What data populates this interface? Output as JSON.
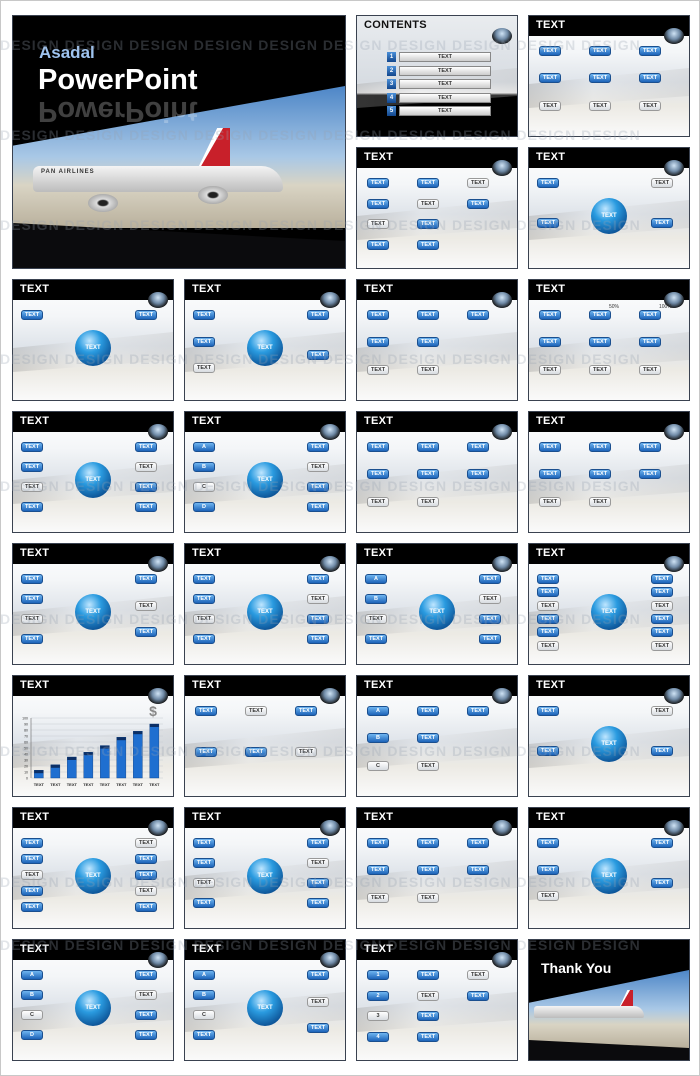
{
  "watermark": "DESIGN DESIGN DESIGN DESIGN DESIGN DESIGN DESIGN DESIGN DESIGN DESIGN",
  "cover": {
    "brand": "Asadal",
    "title": "PowerPoint",
    "plane_text": "PAN AIRLINES"
  },
  "contents": {
    "title": "CONTENTS",
    "items": [
      {
        "num": "1",
        "label": "TEXT"
      },
      {
        "num": "2",
        "label": "TEXT"
      },
      {
        "num": "3",
        "label": "TEXT"
      },
      {
        "num": "4",
        "label": "TEXT"
      },
      {
        "num": "5",
        "label": "TEXT"
      }
    ]
  },
  "slides": [
    {
      "title": "TEXT",
      "labels": [
        "TEXT",
        "TEXT",
        "TEXT",
        "TEXT",
        "TEXT",
        "TEXT",
        "TEXT",
        "TEXT",
        "TEXT"
      ]
    },
    {
      "title": "TEXT",
      "labels": [
        "TEXT",
        "TEXT",
        "TEXT",
        "TEXT",
        "TEXT",
        "TEXT",
        "TEXT",
        "TEXT",
        "TEXT",
        "TEXT"
      ]
    },
    {
      "title": "TEXT",
      "labels": [
        "TEXT",
        "TEXT",
        "TEXT",
        "TEXT"
      ],
      "sphere": "TEXT"
    },
    {
      "title": "TEXT",
      "labels": [
        "TEXT",
        "TEXT"
      ],
      "sphere": "TEXT"
    },
    {
      "title": "TEXT",
      "labels": [
        "TEXT",
        "TEXT",
        "TEXT",
        "TEXT",
        "TEXT"
      ],
      "sphere": "TEXT"
    },
    {
      "title": "TEXT",
      "labels": [
        "TEXT",
        "TEXT",
        "TEXT",
        "TEXT",
        "TEXT",
        "TEXT",
        "TEXT"
      ]
    },
    {
      "title": "TEXT",
      "labels": [
        "TEXT",
        "TEXT",
        "TEXT",
        "TEXT",
        "TEXT",
        "TEXT",
        "TEXT",
        "TEXT",
        "TEXT"
      ],
      "scale": [
        "50%",
        "100%"
      ]
    },
    {
      "title": "TEXT",
      "labels": [
        "TEXT",
        "TEXT",
        "TEXT",
        "TEXT",
        "TEXT",
        "TEXT",
        "TEXT",
        "TEXT"
      ],
      "sphere": "TEXT"
    },
    {
      "title": "TEXT",
      "labels": [
        "A",
        "B",
        "C",
        "D",
        "TEXT",
        "TEXT",
        "TEXT",
        "TEXT"
      ],
      "sphere": "TEXT"
    },
    {
      "title": "TEXT",
      "labels": [
        "TEXT",
        "TEXT",
        "TEXT",
        "TEXT",
        "TEXT",
        "TEXT",
        "TEXT",
        "TEXT"
      ]
    },
    {
      "title": "TEXT",
      "labels": [
        "TEXT",
        "TEXT",
        "TEXT",
        "TEXT",
        "TEXT",
        "TEXT",
        "TEXT",
        "TEXT"
      ]
    },
    {
      "title": "TEXT",
      "labels": [
        "TEXT",
        "TEXT",
        "TEXT",
        "TEXT",
        "TEXT",
        "TEXT",
        "TEXT"
      ],
      "sphere": "TEXT"
    },
    {
      "title": "TEXT",
      "labels": [
        "TEXT",
        "TEXT",
        "TEXT",
        "TEXT",
        "TEXT",
        "TEXT",
        "TEXT",
        "TEXT"
      ],
      "sphere": "TEXT"
    },
    {
      "title": "TEXT",
      "labels": [
        "A",
        "B",
        "TEXT",
        "TEXT",
        "TEXT",
        "TEXT",
        "TEXT",
        "TEXT"
      ],
      "sphere": "TEXT"
    },
    {
      "title": "TEXT",
      "labels": [
        "TEXT",
        "TEXT",
        "TEXT",
        "TEXT",
        "TEXT",
        "TEXT",
        "TEXT",
        "TEXT",
        "TEXT",
        "TEXT",
        "TEXT",
        "TEXT"
      ],
      "sphere": "TEXT"
    },
    {
      "title": "TEXT",
      "chart": true
    },
    {
      "title": "TEXT",
      "labels": [
        "TEXT",
        "TEXT",
        "TEXT",
        "TEXT",
        "TEXT",
        "TEXT"
      ]
    },
    {
      "title": "TEXT",
      "labels": [
        "A",
        "B",
        "C",
        "TEXT",
        "TEXT",
        "TEXT",
        "TEXT"
      ]
    },
    {
      "title": "TEXT",
      "labels": [
        "TEXT",
        "TEXT",
        "TEXT",
        "TEXT"
      ],
      "sphere": "TEXT"
    },
    {
      "title": "TEXT",
      "labels": [
        "TEXT",
        "TEXT",
        "TEXT",
        "TEXT",
        "TEXT",
        "TEXT",
        "TEXT",
        "TEXT",
        "TEXT",
        "TEXT"
      ],
      "sphere": "TEXT"
    },
    {
      "title": "TEXT",
      "labels": [
        "TEXT",
        "TEXT",
        "TEXT",
        "TEXT",
        "TEXT",
        "TEXT",
        "TEXT",
        "TEXT"
      ],
      "sphere": "TEXT"
    },
    {
      "title": "TEXT",
      "labels": [
        "TEXT",
        "TEXT",
        "TEXT",
        "TEXT",
        "TEXT",
        "TEXT",
        "TEXT",
        "TEXT"
      ]
    },
    {
      "title": "TEXT",
      "labels": [
        "TEXT",
        "TEXT",
        "TEXT",
        "TEXT",
        "TEXT"
      ],
      "sphere": "TEXT"
    },
    {
      "title": "TEXT",
      "labels": [
        "A",
        "B",
        "C",
        "D",
        "TEXT",
        "TEXT",
        "TEXT",
        "TEXT"
      ],
      "sphere": "TEXT"
    },
    {
      "title": "TEXT",
      "labels": [
        "A",
        "B",
        "C",
        "TEXT",
        "TEXT",
        "TEXT",
        "TEXT"
      ],
      "sphere": "TEXT"
    },
    {
      "title": "TEXT",
      "labels": [
        "1",
        "2",
        "3",
        "4",
        "TEXT",
        "TEXT",
        "TEXT",
        "TEXT",
        "TEXT",
        "TEXT"
      ]
    }
  ],
  "thanks": {
    "title": "Thank You"
  },
  "chart_data": {
    "type": "bar",
    "categories": [
      "TEXT",
      "TEXT",
      "TEXT",
      "TEXT",
      "TEXT",
      "TEXT",
      "TEXT",
      "TEXT"
    ],
    "values": [
      13,
      22,
      35,
      43,
      54,
      68,
      78,
      90
    ],
    "yticks": [
      "0",
      "10",
      "20",
      "30",
      "40",
      "50",
      "60",
      "70",
      "80",
      "90",
      "100"
    ],
    "ylim": [
      0,
      100
    ],
    "grid": true,
    "color": "#1f6fd0",
    "icon": "dollar-icon"
  }
}
